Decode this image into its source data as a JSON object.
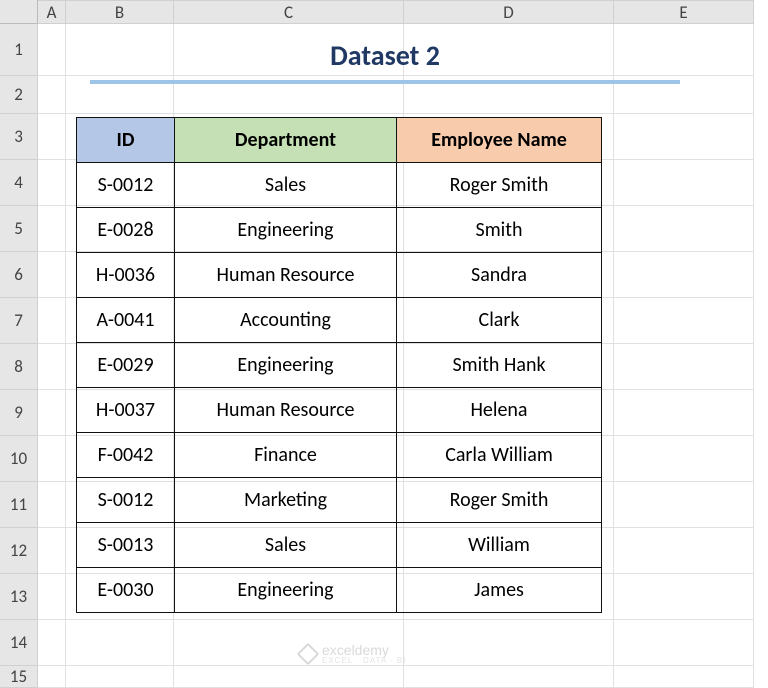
{
  "columns": [
    "A",
    "B",
    "C",
    "D",
    "E"
  ],
  "row_labels": [
    "1",
    "2",
    "3",
    "4",
    "5",
    "6",
    "7",
    "8",
    "9",
    "10",
    "11",
    "12",
    "13",
    "14",
    "15"
  ],
  "title": "Dataset 2",
  "headers": {
    "id": "ID",
    "dept": "Department",
    "name": "Employee Name"
  },
  "data": [
    {
      "id": "S-0012",
      "dept": "Sales",
      "name": "Roger Smith"
    },
    {
      "id": "E-0028",
      "dept": "Engineering",
      "name": "Smith"
    },
    {
      "id": "H-0036",
      "dept": "Human Resource",
      "name": "Sandra"
    },
    {
      "id": "A-0041",
      "dept": "Accounting",
      "name": "Clark"
    },
    {
      "id": "E-0029",
      "dept": "Engineering",
      "name": "Smith Hank"
    },
    {
      "id": "H-0037",
      "dept": "Human Resource",
      "name": "Helena"
    },
    {
      "id": "F-0042",
      "dept": "Finance",
      "name": "Carla William"
    },
    {
      "id": "S-0012",
      "dept": "Marketing",
      "name": "Roger Smith"
    },
    {
      "id": "S-0013",
      "dept": "Sales",
      "name": "William"
    },
    {
      "id": "E-0030",
      "dept": "Engineering",
      "name": "James"
    }
  ],
  "watermark": {
    "text": "exceldemy",
    "sub": "EXCEL · DATA · BI"
  },
  "chart_data": {
    "type": "table",
    "title": "Dataset 2",
    "columns": [
      "ID",
      "Department",
      "Employee Name"
    ],
    "rows": [
      [
        "S-0012",
        "Sales",
        "Roger Smith"
      ],
      [
        "E-0028",
        "Engineering",
        "Smith"
      ],
      [
        "H-0036",
        "Human Resource",
        "Sandra"
      ],
      [
        "A-0041",
        "Accounting",
        "Clark"
      ],
      [
        "E-0029",
        "Engineering",
        "Smith Hank"
      ],
      [
        "H-0037",
        "Human Resource",
        "Helena"
      ],
      [
        "F-0042",
        "Finance",
        "Carla William"
      ],
      [
        "S-0012",
        "Marketing",
        "Roger Smith"
      ],
      [
        "S-0013",
        "Sales",
        "William"
      ],
      [
        "E-0030",
        "Engineering",
        "James"
      ]
    ]
  }
}
